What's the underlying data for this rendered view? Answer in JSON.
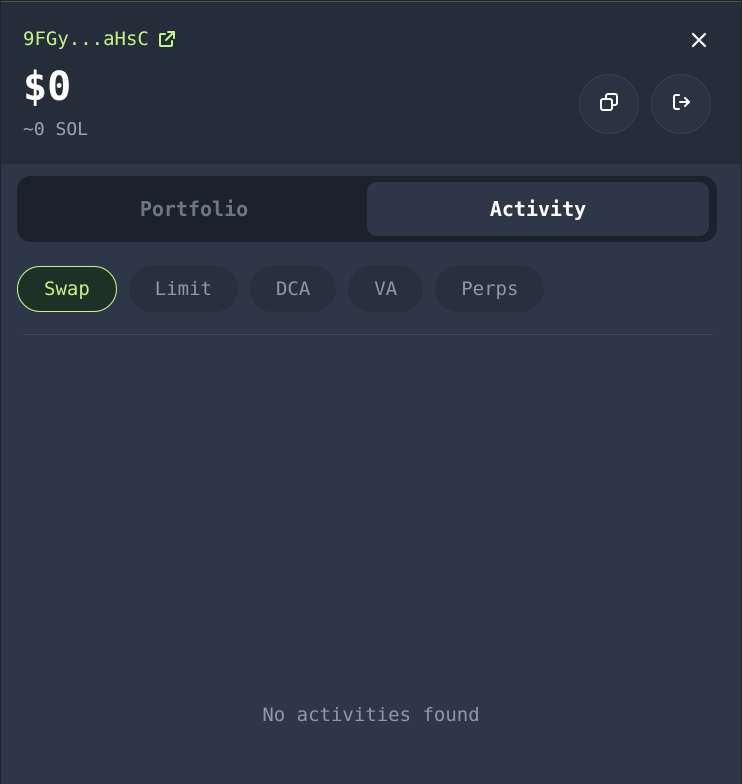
{
  "header": {
    "address": "9FGy...aHsC",
    "balance": "$0",
    "sol_balance": "~0 SOL",
    "icons": {
      "external": "external-link-icon",
      "close": "close-icon",
      "copy": "copy-icon",
      "logout": "logout-icon"
    }
  },
  "tabs": [
    {
      "label": "Portfolio",
      "active": false
    },
    {
      "label": "Activity",
      "active": true
    }
  ],
  "filters": [
    {
      "label": "Swap",
      "active": true
    },
    {
      "label": "Limit",
      "active": false
    },
    {
      "label": "DCA",
      "active": false
    },
    {
      "label": "VA",
      "active": false
    },
    {
      "label": "Perps",
      "active": false
    }
  ],
  "activity": {
    "empty_message": "No activities found"
  },
  "colors": {
    "accent": "#c7f284",
    "background": "#2e3748",
    "header": "#252d3a"
  }
}
